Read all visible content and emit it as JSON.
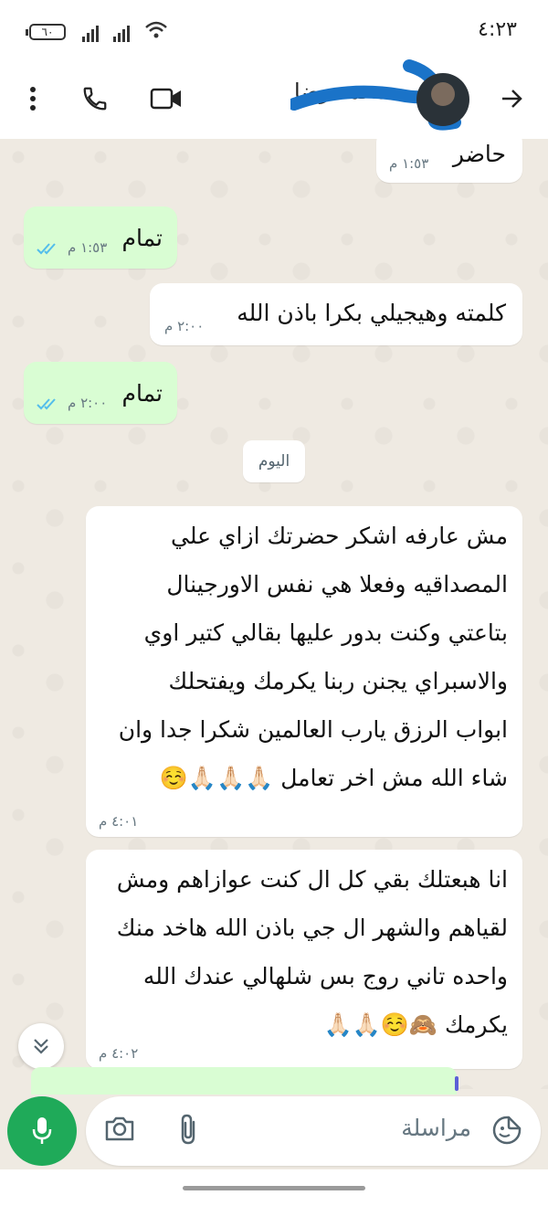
{
  "status_bar": {
    "time": "٤:٢٣",
    "battery": "٦٠"
  },
  "header": {
    "contact_name": "محمد رضا",
    "icons": [
      "more-vert-icon",
      "phone-icon",
      "video-icon",
      "back-arrow-icon"
    ]
  },
  "messages": [
    {
      "direction": "in",
      "text": "حاضر",
      "time": "١:٥٣ م"
    },
    {
      "direction": "out",
      "text": "تمام",
      "time": "١:٥٣ م",
      "status": "read"
    },
    {
      "direction": "in",
      "text": "كلمته وهيجيلي بكرا باذن الله",
      "time": "٢:٠٠ م"
    },
    {
      "direction": "out",
      "text": "تمام",
      "time": "٢:٠٠ م",
      "status": "read"
    },
    {
      "direction": "in",
      "lines": [
        "مش عارفه اشكر حضرتك ازاي علي",
        "المصداقيه وفعلا هي نفس الاورجينال",
        "بتاعتي وكنت بدور عليها بقالي كتير اوي",
        "والاسبراي يجنن ربنا يكرمك ويفتحلك",
        "ابواب الرزق يارب العالمين شكرا جدا وان",
        "شاء الله مش اخر تعامل 🙏🏻🙏🏻🙏🏻☺️"
      ],
      "time": "٤:٠١ م"
    },
    {
      "direction": "in",
      "lines": [
        "انا هبعتلك بقي كل ال كنت عوازاهم ومش",
        "لقياهم والشهر ال جي باذن الله هاخد منك",
        "واحده تاني روج بس شلهالي عندك الله",
        "يكرمك 🙈☺️🙏🏻🙏🏻"
      ],
      "time": "٤:٠٢ م"
    }
  ],
  "day_separator": "اليوم",
  "composer": {
    "placeholder": "مراسلة"
  },
  "colors": {
    "outgoing_bubble": "#d9fdd3",
    "incoming_bubble": "#ffffff",
    "chat_background": "#efeae2",
    "mic_button": "#1faa59",
    "read_ticks": "#53bdeb"
  }
}
